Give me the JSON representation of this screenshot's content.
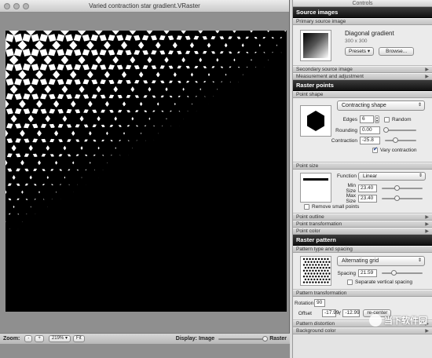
{
  "window": {
    "title": "Varied contraction star gradient.VRaster"
  },
  "statusbar": {
    "zoom_label": "Zoom:",
    "zoom_out": "-",
    "zoom_in": "+",
    "zoom_value": "219%",
    "zoom_arrow": "▾",
    "fit_label": "Fit",
    "display_label": "Display: Image",
    "raster_label": "Raster"
  },
  "controls": {
    "title": "Controls",
    "source_images": {
      "header": "Source images",
      "primary_label": "Primary source image",
      "image_name": "Diagonal gradient",
      "image_size": "300 x 300",
      "presets_label": "Presets",
      "browse_label": "Browse...",
      "secondary_label": "Secondary source image",
      "measurement_label": "Measurement and adjustment"
    },
    "raster_points": {
      "header": "Raster points",
      "point_shape_label": "Point shape",
      "shape_value": "Contracting shape",
      "edges_label": "Edges",
      "edges_value": "6",
      "random_label": "Random",
      "rounding_label": "Rounding",
      "rounding_value": "0.00",
      "contraction_label": "Contraction",
      "contraction_value": "-25.8",
      "vary_contraction_label": "Vary contraction",
      "vary_contraction_checked": true,
      "point_size_label": "Point size",
      "function_label": "Function",
      "function_value": "Linear",
      "min_size_label": "Min Size",
      "min_size_value": "23.40",
      "max_size_label": "Max Size",
      "max_size_value": "23.40",
      "remove_small_label": "Remove small points",
      "point_outline_label": "Point outline",
      "point_transformation_label": "Point transformation",
      "point_color_label": "Point color"
    },
    "raster_pattern": {
      "header": "Raster pattern",
      "type_spacing_label": "Pattern type and spacing",
      "pattern_value": "Alternating grid",
      "spacing_label": "Spacing",
      "spacing_value": "21.59",
      "separate_vertical_label": "Separate vertical spacing",
      "transformation_label": "Pattern transformation",
      "rotation_label": "Rotation",
      "rotation_value": "90",
      "offset_label": "Offset",
      "offset_x": "-17.99",
      "offset_y": "-12.99",
      "recenter_label": "re-center",
      "distortion_label": "Pattern distortion",
      "background_label": "Background color"
    }
  },
  "watermark": {
    "text": "当下软件园"
  },
  "colors": {
    "header_bg": "#1e1e1e",
    "canvas_bg": "#ffffff",
    "window_bg": "#8f8f8f"
  }
}
